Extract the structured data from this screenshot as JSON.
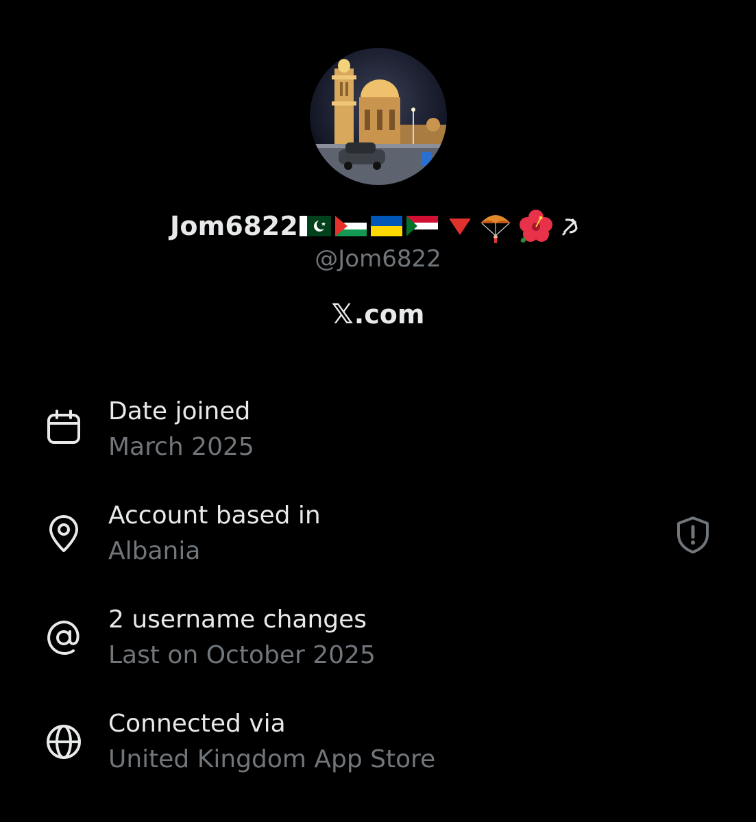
{
  "profile": {
    "display_name": "Jom6822",
    "name_emojis": [
      "pakistan-flag",
      "palestine-flag",
      "ukraine-flag",
      "sudan-flag",
      "red-triangle",
      "parachute",
      "hibiscus",
      "hammer-and-sickle"
    ],
    "handle": "@Jom6822",
    "website_logo": "𝕏",
    "website_rest": ".com"
  },
  "info": {
    "date_joined": {
      "title": "Date joined",
      "value": "March 2025",
      "icon": "calendar-icon"
    },
    "based_in": {
      "title": "Account based in",
      "value": "Albania",
      "icon": "location-pin-icon",
      "badge_icon": "shield-alert-icon"
    },
    "username_changes": {
      "title": "2 username changes",
      "value": "Last on October 2025",
      "icon": "at-sign-icon"
    },
    "connected_via": {
      "title": "Connected via",
      "value": "United Kingdom App Store",
      "icon": "globe-icon"
    }
  },
  "colors": {
    "background": "#000000",
    "primary_text": "#e7e9ea",
    "secondary_text": "#71767b"
  }
}
